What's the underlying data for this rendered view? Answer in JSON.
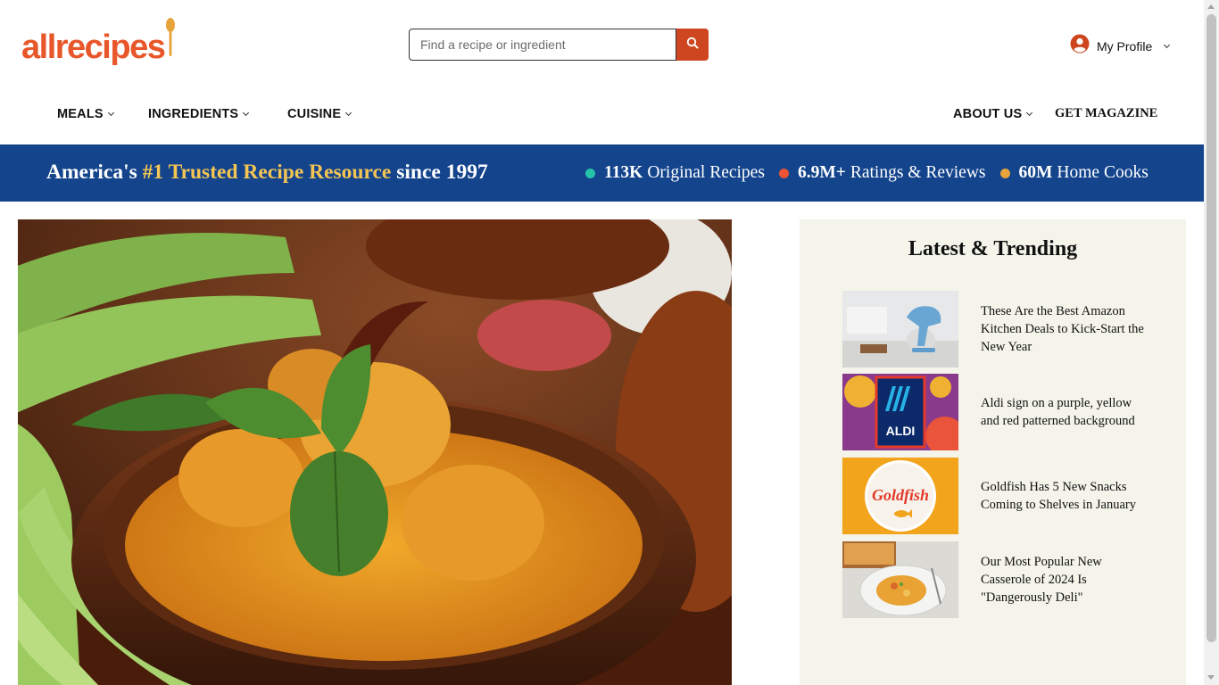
{
  "header": {
    "logo_text": "allrecipes",
    "search": {
      "placeholder": "Find a recipe or ingredient",
      "value": ""
    },
    "profile_label": "My Profile"
  },
  "nav": {
    "meals": "MEALS",
    "ingredients": "INGREDIENTS",
    "cuisine": "CUISINE",
    "about": "ABOUT US",
    "magazine": "GET MAGAZINE"
  },
  "banner": {
    "tagline_pre": "America's ",
    "tagline_highlight": "#1 Trusted Recipe Resource",
    "tagline_post": " since 1997",
    "stats": [
      {
        "value": "113K",
        "label": "Original Recipes",
        "color": "#27c3a9"
      },
      {
        "value": "6.9M+",
        "label": "Ratings & Reviews",
        "color": "#ee5535"
      },
      {
        "value": "60M",
        "label": "Home Cooks",
        "color": "#e6a43a"
      }
    ]
  },
  "trending": {
    "title": "Latest & Trending",
    "items": [
      {
        "text": "These Are the Best Amazon Kitchen Deals to Kick-Start the New Year"
      },
      {
        "text": "Aldi sign on a purple, yellow and red patterned background",
        "logo": "ALDI"
      },
      {
        "text": "Goldfish Has 5 New Snacks Coming to Shelves in January",
        "logo": "Goldfish"
      },
      {
        "text": "Our Most Popular New Casserole of 2024 Is \"Dangerously Deli\""
      }
    ]
  },
  "colors": {
    "brand_orange": "#e8572a",
    "search_button": "#ce4620",
    "banner_blue": "#13448c",
    "highlight_yellow": "#f6c654",
    "trending_bg": "#f4f4ea"
  }
}
